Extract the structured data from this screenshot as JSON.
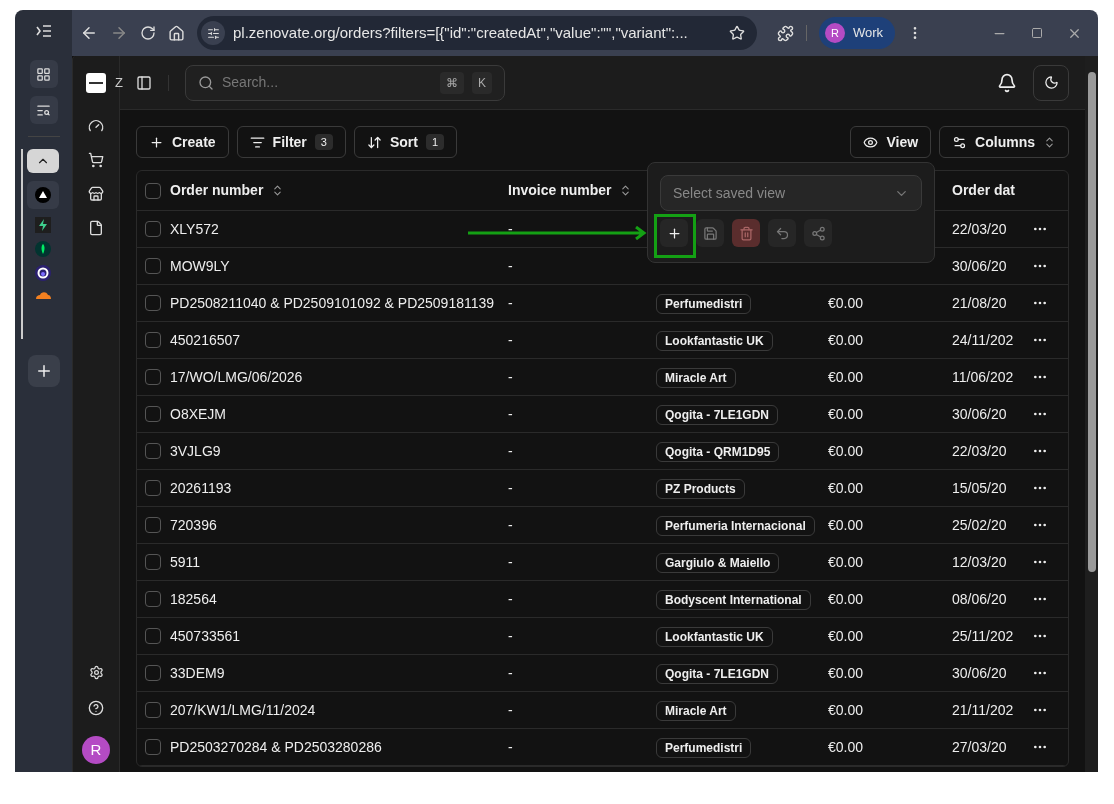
{
  "browser": {
    "url": "pl.zenovate.org/orders?filters=[{\"id\":\"createdAt\",\"value\":\"\",\"variant\":...",
    "profile": {
      "initial": "R",
      "name": "Work"
    }
  },
  "app": {
    "brand_cut": "Z",
    "user_initial": "R"
  },
  "search": {
    "placeholder": "Search...",
    "keys": [
      "⌘",
      "K"
    ]
  },
  "toolbar": {
    "create": "Create",
    "filter": {
      "label": "Filter",
      "count": "3"
    },
    "sort": {
      "label": "Sort",
      "count": "1"
    },
    "view": "View",
    "columns": "Columns"
  },
  "popover": {
    "placeholder": "Select saved view",
    "actions": [
      {
        "kind": "add",
        "disabled": false
      },
      {
        "kind": "save",
        "disabled": true
      },
      {
        "kind": "delete",
        "disabled": true
      },
      {
        "kind": "undo",
        "disabled": true
      },
      {
        "kind": "share",
        "disabled": true
      }
    ]
  },
  "table": {
    "select_all_checked": false,
    "columns": [
      {
        "label": "Order number"
      },
      {
        "label": "Invoice number"
      },
      {
        "label": "Order dat"
      }
    ],
    "rows": [
      {
        "checked": false,
        "order": "XLY572",
        "invoice": "-",
        "date": "22/03/20"
      },
      {
        "checked": false,
        "order": "MOW9LY",
        "invoice": "-",
        "date": "30/06/20"
      },
      {
        "checked": false,
        "order": "PD2508211040 & PD2509101092 & PD2509181139",
        "invoice": "-",
        "store": "Perfumedistri",
        "amount": "€0.00",
        "date": "21/08/20"
      },
      {
        "checked": false,
        "order": "450216507",
        "invoice": "-",
        "store": "Lookfantastic UK",
        "amount": "€0.00",
        "date": "24/11/202"
      },
      {
        "checked": false,
        "order": "17/WO/LMG/06/2026",
        "invoice": "-",
        "store": "Miracle Art",
        "amount": "€0.00",
        "date": "11/06/202"
      },
      {
        "checked": false,
        "order": "O8XEJM",
        "invoice": "-",
        "store": "Qogita - 7LE1GDN",
        "amount": "€0.00",
        "date": "30/06/20"
      },
      {
        "checked": false,
        "order": "3VJLG9",
        "invoice": "-",
        "store": "Qogita - QRM1D95",
        "amount": "€0.00",
        "date": "22/03/20"
      },
      {
        "checked": false,
        "order": "20261193",
        "invoice": "-",
        "store": "PZ Products",
        "amount": "€0.00",
        "date": "15/05/20"
      },
      {
        "checked": false,
        "order": "720396",
        "invoice": "-",
        "store": "Perfumeria Internacional",
        "amount": "€0.00",
        "date": "25/02/20"
      },
      {
        "checked": false,
        "order": "5911",
        "invoice": "-",
        "store": "Gargiulo & Maiello",
        "amount": "€0.00",
        "date": "12/03/20"
      },
      {
        "checked": false,
        "order": "182564",
        "invoice": "-",
        "store": "Bodyscent International",
        "amount": "€0.00",
        "date": "08/06/20"
      },
      {
        "checked": false,
        "order": "450733561",
        "invoice": "-",
        "store": "Lookfantastic UK",
        "amount": "€0.00",
        "date": "25/11/202"
      },
      {
        "checked": false,
        "order": "33DEM9",
        "invoice": "-",
        "store": "Qogita - 7LE1GDN",
        "amount": "€0.00",
        "date": "30/06/20"
      },
      {
        "checked": false,
        "order": "207/KW1/LMG/11/2024",
        "invoice": "-",
        "store": "Miracle Art",
        "amount": "€0.00",
        "date": "21/11/202"
      },
      {
        "checked": false,
        "order": "PD2503270284 & PD2503280286",
        "invoice": "-",
        "store": "Perfumedistri",
        "amount": "€0.00",
        "date": "27/03/20"
      }
    ]
  }
}
